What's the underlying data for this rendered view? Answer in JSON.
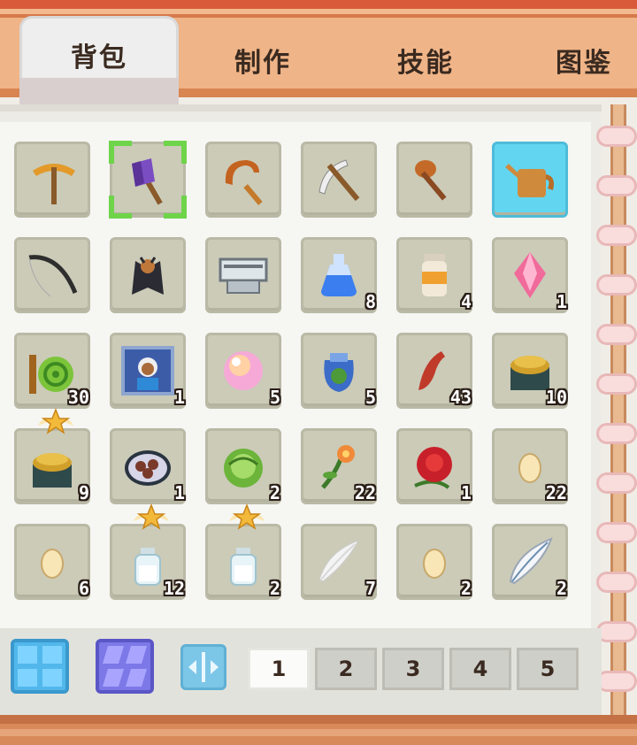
{
  "tabs": [
    {
      "label": "背包",
      "active": true
    },
    {
      "label": "制作",
      "active": false
    },
    {
      "label": "技能",
      "active": false
    },
    {
      "label": "图鉴",
      "active": false
    }
  ],
  "inventory": [
    {
      "icon": "pickaxe-icon",
      "count": ""
    },
    {
      "icon": "axe-icon",
      "count": "",
      "selected": true
    },
    {
      "icon": "sickle-icon",
      "count": ""
    },
    {
      "icon": "scythe-icon",
      "count": ""
    },
    {
      "icon": "shovel-icon",
      "count": ""
    },
    {
      "icon": "watering-can-icon",
      "count": "",
      "highlight": true
    },
    {
      "icon": "fishing-rod-icon",
      "count": ""
    },
    {
      "icon": "bat-costume-icon",
      "count": ""
    },
    {
      "icon": "machine-icon",
      "count": ""
    },
    {
      "icon": "blue-potion-icon",
      "count": "8"
    },
    {
      "icon": "orange-jar-icon",
      "count": "4"
    },
    {
      "icon": "pink-crystal-icon",
      "count": "1"
    },
    {
      "icon": "fiber-bundle-icon",
      "count": "30"
    },
    {
      "icon": "portrait-icon",
      "count": "1"
    },
    {
      "icon": "pearl-icon",
      "count": "5"
    },
    {
      "icon": "herb-pouch-icon",
      "count": "5"
    },
    {
      "icon": "red-chili-icon",
      "count": "43"
    },
    {
      "icon": "gold-pot-icon",
      "count": "10"
    },
    {
      "icon": "gold-pot-star-icon",
      "count": "9",
      "star": true
    },
    {
      "icon": "dish-icon",
      "count": "1"
    },
    {
      "icon": "cabbage-icon",
      "count": "2"
    },
    {
      "icon": "orange-flower-icon",
      "count": "22"
    },
    {
      "icon": "red-rose-icon",
      "count": "1"
    },
    {
      "icon": "egg-icon",
      "count": "22"
    },
    {
      "icon": "egg-icon",
      "count": "6"
    },
    {
      "icon": "milk-bottle-star-icon",
      "count": "12",
      "star": true
    },
    {
      "icon": "milk-bottle-star-icon",
      "count": "2",
      "star": true
    },
    {
      "icon": "white-feather-icon",
      "count": "7"
    },
    {
      "icon": "egg-icon",
      "count": "2"
    },
    {
      "icon": "silver-feather-icon",
      "count": "2"
    }
  ],
  "pages": [
    "1",
    "2",
    "3",
    "4",
    "5"
  ],
  "active_page": "1",
  "colors": {
    "frame": "#efb487",
    "slot": "#cbcbb8",
    "selection": "#6ed44a",
    "highlight": "#62d6f0"
  }
}
